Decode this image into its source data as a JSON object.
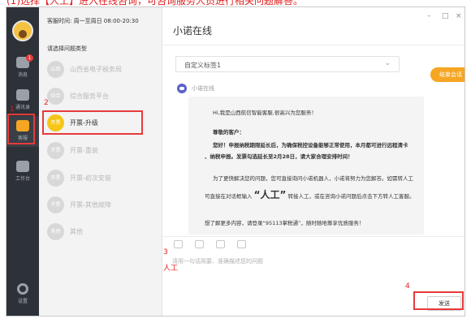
{
  "top_note": "(1)选择【人工】进入在线咨询，可咨询服务人员进行相关问题解答。",
  "sidebar": {
    "items": [
      {
        "label": "消息",
        "badge": "1"
      },
      {
        "label": "通讯录"
      },
      {
        "label": "客服"
      },
      {
        "label": "工作台"
      }
    ],
    "settings_label": "设置"
  },
  "categories": {
    "service_hours": "客服时间: 周一至周日 08:00-20:30",
    "select_label": "请选择问题类型",
    "items": [
      {
        "icon": "山西",
        "label": "山西省电子税务局"
      },
      {
        "icon": "综合",
        "label": "综合服务平台"
      },
      {
        "icon": "开票",
        "label": "开票-升级"
      },
      {
        "icon": "开票",
        "label": "开票-重装"
      },
      {
        "icon": "开票",
        "label": "开票-初次安装"
      },
      {
        "icon": "开票",
        "label": "开票-其他故障"
      },
      {
        "icon": "其他",
        "label": "其他"
      }
    ]
  },
  "chat": {
    "title": "小诺在线",
    "window_controls": [
      "–",
      "□",
      "×"
    ],
    "tag_select_value": "自定义标签1",
    "end_button": "结束会话",
    "bot_name": "小诺在线",
    "message": {
      "greeting": "Hi,我是山西航信智能客服,很高兴为您服务！",
      "dear": "尊敬的客户：",
      "notice_1": "您好！申报纳税期限延长后，为确保税控设备能够正常使用，本月都可进行远程清卡",
      "notice_2": "、纳税申报。发票勾选延长至2月28日，请大家合理安排时间！",
      "help_1a": "为了更快解决您的问题，您可直接询问小诺机器人，小诺将努力为您解答。如需转人工",
      "help_2a": "可直接在对话框输入",
      "help_2_word": "“人工”",
      "help_2b": "转接人工，或在咨询小诺问题后点击下方转人工客服。",
      "more_1": "想了解更多内容，请登录“95113掌税通”，随时随地尊享优质服务！"
    },
    "input_placeholder": "请用一句话简要、准确描述您的问题",
    "send_label": "发送"
  },
  "annotations": {
    "step1": "1",
    "step2": "2",
    "step3": "3",
    "step3_text": "人工",
    "step4": "4"
  },
  "colors": {
    "accent": "#f5a623",
    "annotation_red": "#e83a3a",
    "nav_bg": "#2d3138"
  }
}
